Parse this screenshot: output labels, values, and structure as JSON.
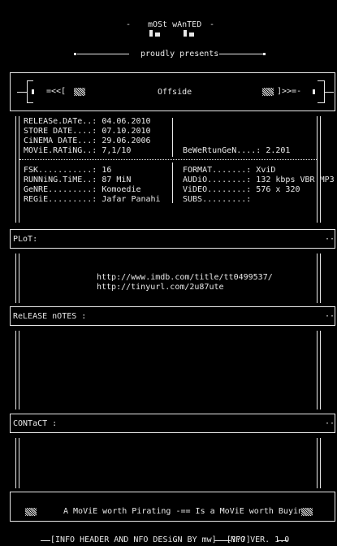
{
  "header": {
    "title": "mOSt wAnTED",
    "dash_left": "-",
    "dash_right": "-",
    "presents": "proudly presents"
  },
  "banner": {
    "left_arrow": "=<<[",
    "right_arrow": "]>>=-",
    "movie_title": "Offside"
  },
  "info": {
    "release_date": "RELEASe.DATe..: 04.06.2010",
    "store_date": "STORE DATE....: 07.10.2010",
    "cinema_date": "CiNEMA DATE...: 29.06.2006",
    "movie_rating": "MOViE.RATiNG..: 7,1/10",
    "rating_votes": "BeWeRtunGeN....: 2.201",
    "fsk": "FSK...........: 16",
    "running_time": "RUNNiNG.TiME..: 87 MiN",
    "genre": "GeNRE.........: Komoedie",
    "regie": "REGiE.........: Jafar Panahi",
    "format": "FORMAT.......: XviD",
    "audio": "AUDiO........: 132 kbps VBR MP3",
    "video": "ViDEO........: 576 x 320",
    "subs": "SUBS.........:"
  },
  "plot": {
    "heading": "PLoT:",
    "imdb_url": "http://www.imdb.com/title/tt0499537/",
    "tiny_url": "http://tinyurl.com/2u87ute"
  },
  "release_notes": {
    "heading": "ReLEASE nOTES :"
  },
  "contact": {
    "heading": "CONTaCT :"
  },
  "footer_banner": {
    "slogan": "A MoViE worth Pirating -== Is a MoViE worth Buying"
  },
  "footer": {
    "credits": "INFO HEADER AND NFO DESiGN BY mw]  [???]",
    "version": "NFO VER. 1.0"
  }
}
